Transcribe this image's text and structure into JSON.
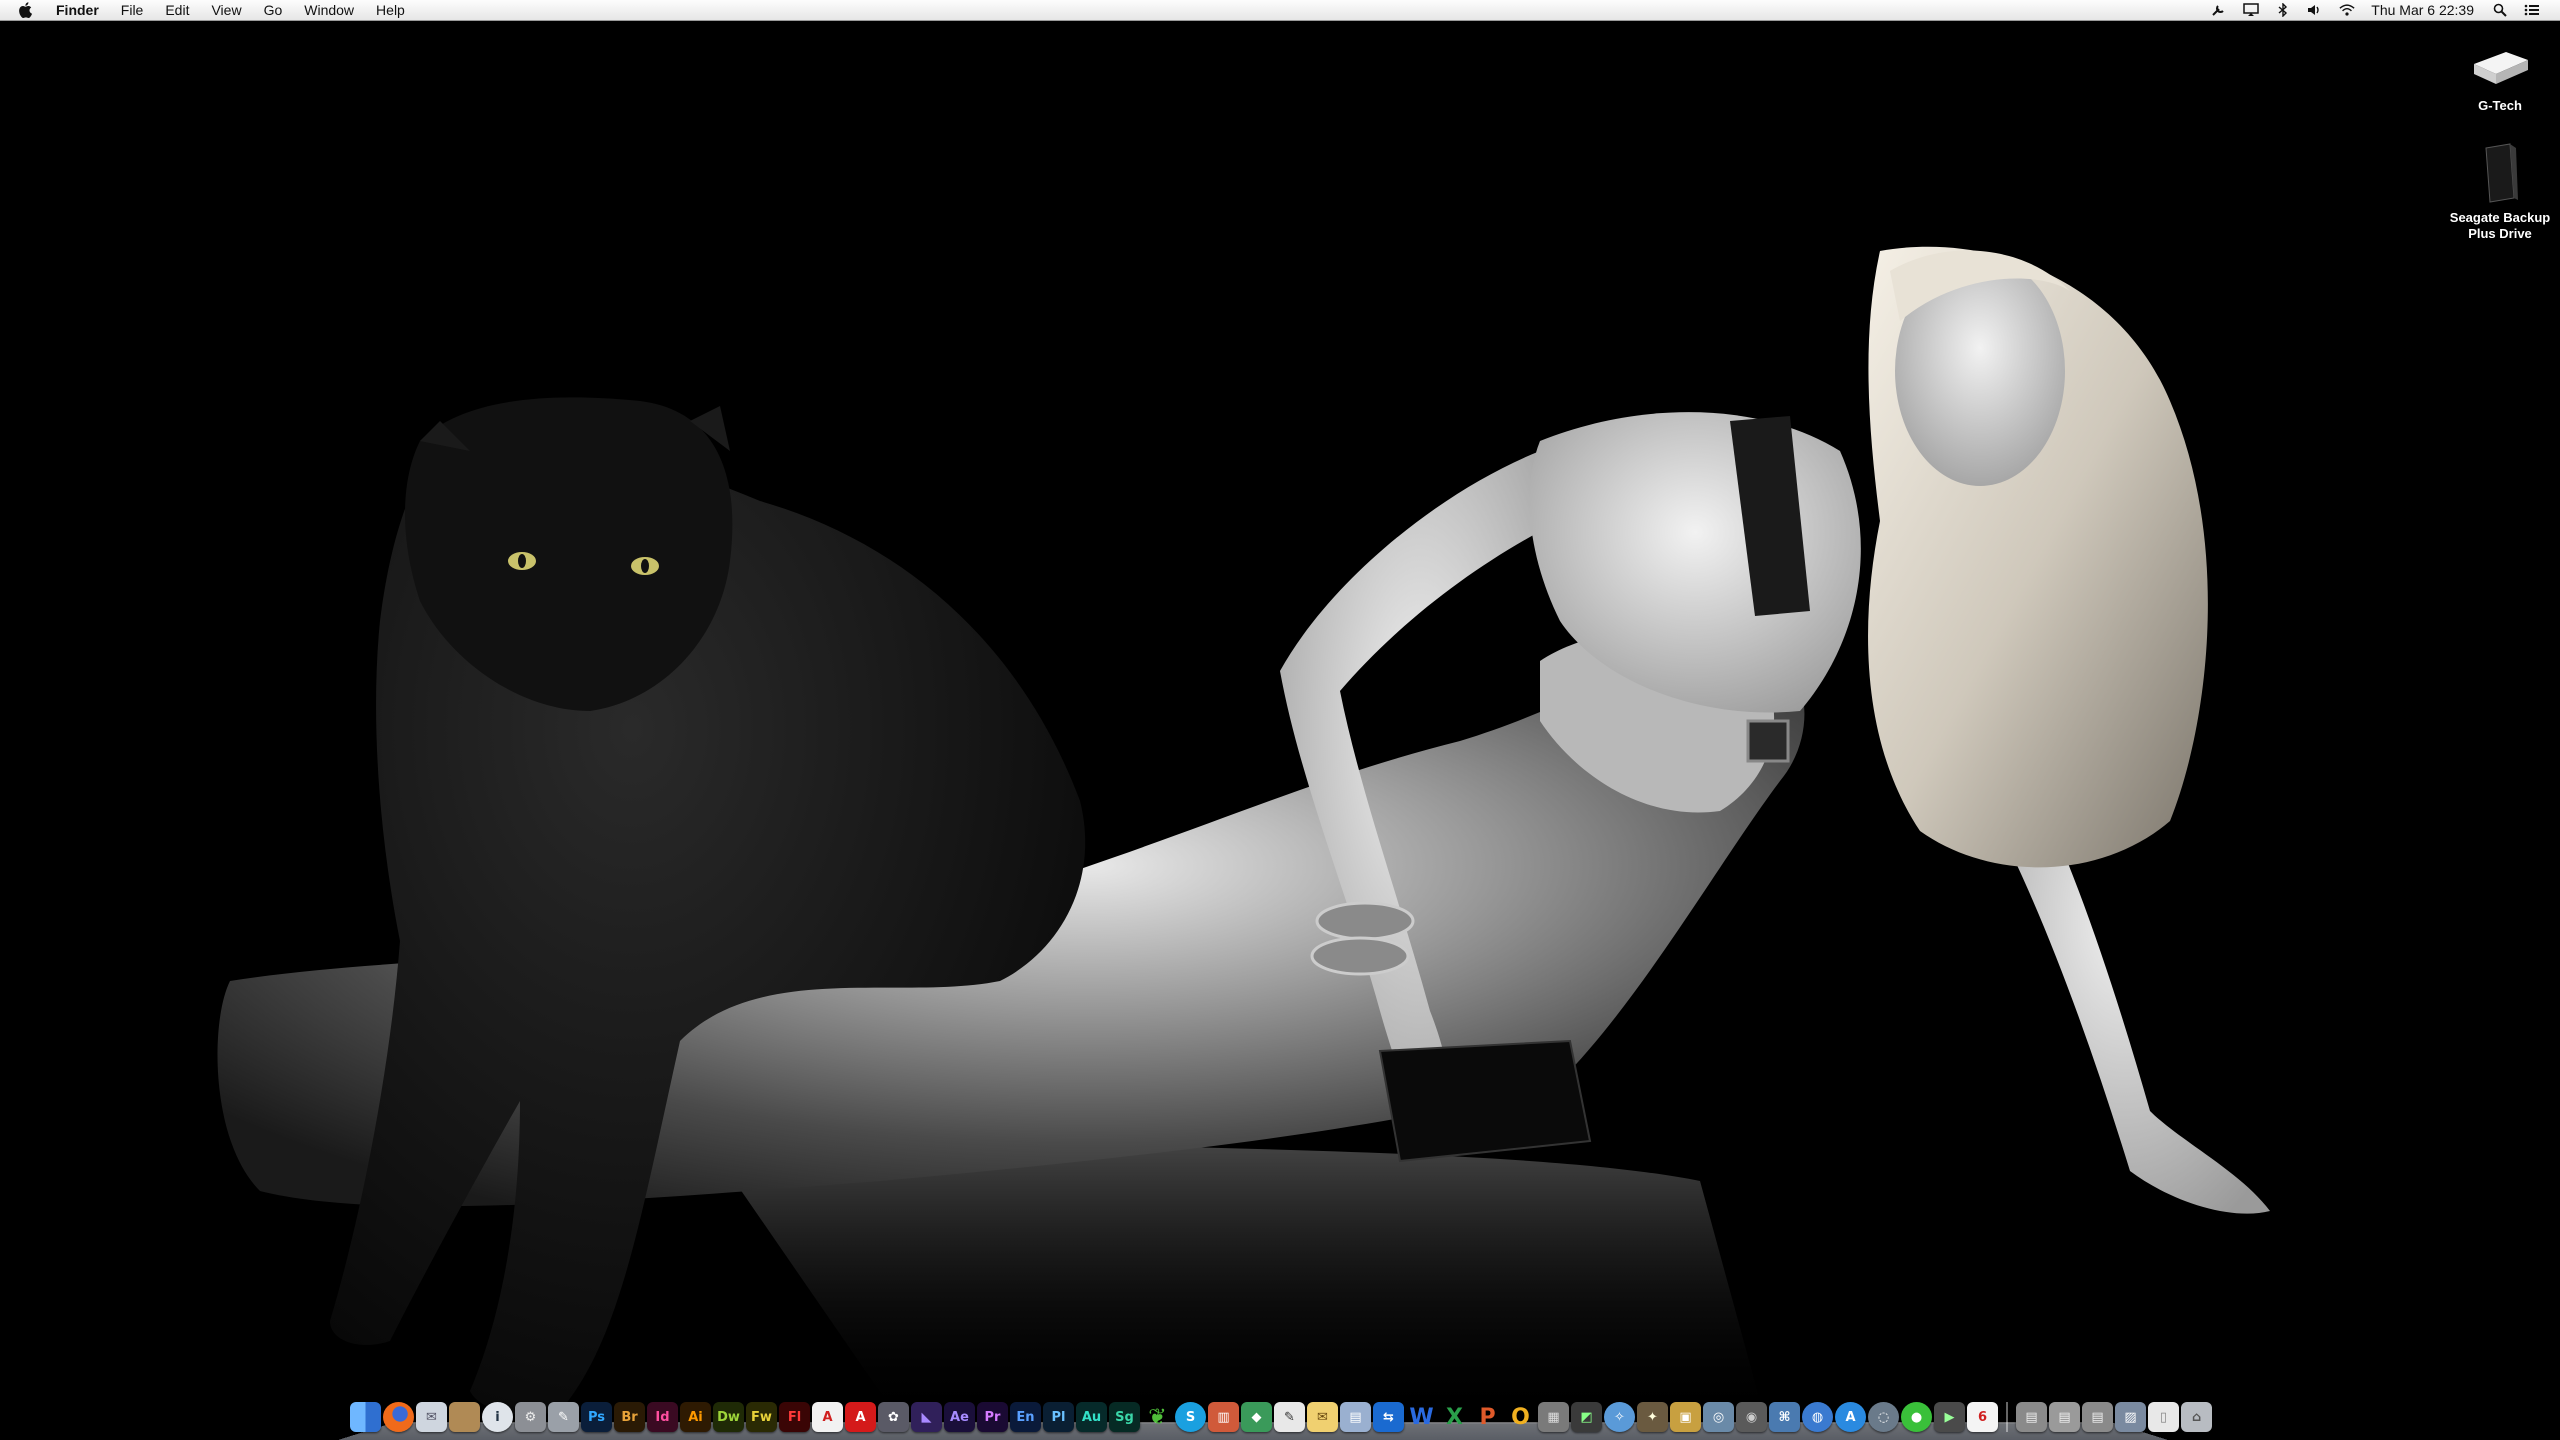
{
  "menubar": {
    "app_name": "Finder",
    "menus": [
      "File",
      "Edit",
      "View",
      "Go",
      "Window",
      "Help"
    ],
    "status_icons": [
      "wrench-icon",
      "display-icon",
      "bluetooth-icon",
      "volume-icon",
      "wifi-icon"
    ],
    "clock": "Thu Mar 6  22:39"
  },
  "desktop": {
    "icons": [
      {
        "name": "G-Tech",
        "type": "external-drive"
      },
      {
        "name": "Seagate Backup Plus Drive",
        "type": "external-drive"
      }
    ]
  },
  "dock": {
    "apps": [
      {
        "name": "finder-icon",
        "text": "",
        "bg": "#3b7fd6",
        "fg": "#fff",
        "shape": "square"
      },
      {
        "name": "firefox-icon",
        "text": "",
        "bg": "#e14d22",
        "fg": "#fff",
        "shape": "round"
      },
      {
        "name": "mail-icon",
        "text": "✉",
        "bg": "#cfd6df",
        "fg": "#556",
        "shape": "square"
      },
      {
        "name": "address-book-icon",
        "text": "",
        "bg": "#b08a55",
        "fg": "#fff",
        "shape": "square"
      },
      {
        "name": "info-icon",
        "text": "i",
        "bg": "#dfe4ea",
        "fg": "#234",
        "shape": "round"
      },
      {
        "name": "system-preferences-icon",
        "text": "⚙",
        "bg": "#8c8f95",
        "fg": "#eee",
        "shape": "square"
      },
      {
        "name": "script-editor-icon",
        "text": "✎",
        "bg": "#9aa0a8",
        "fg": "#fff",
        "shape": "square"
      },
      {
        "name": "photoshop-icon",
        "text": "Ps",
        "bg": "#0a1e3a",
        "fg": "#31a8ff",
        "shape": "square"
      },
      {
        "name": "bridge-icon",
        "text": "Br",
        "bg": "#2a1a05",
        "fg": "#e8a33a",
        "shape": "square"
      },
      {
        "name": "indesign-icon",
        "text": "Id",
        "bg": "#3a0a22",
        "fg": "#ff4fa0",
        "shape": "square"
      },
      {
        "name": "illustrator-icon",
        "text": "Ai",
        "bg": "#2e1a02",
        "fg": "#ff9a00",
        "shape": "square"
      },
      {
        "name": "dreamweaver-icon",
        "text": "Dw",
        "bg": "#1f2a06",
        "fg": "#9ed63a",
        "shape": "square"
      },
      {
        "name": "fireworks-icon",
        "text": "Fw",
        "bg": "#2a2a04",
        "fg": "#e8d23a",
        "shape": "square"
      },
      {
        "name": "flash-icon",
        "text": "Fl",
        "bg": "#3a0505",
        "fg": "#ff3a3a",
        "shape": "square"
      },
      {
        "name": "acrobat-icon",
        "text": "A",
        "bg": "#f2f2f2",
        "fg": "#d02020",
        "shape": "square"
      },
      {
        "name": "adobe-icon",
        "text": "A",
        "bg": "#d41a1a",
        "fg": "#fff",
        "shape": "square"
      },
      {
        "name": "media-encoder-icon",
        "text": "✿",
        "bg": "#5a5a66",
        "fg": "#fff",
        "shape": "square"
      },
      {
        "name": "extension-manager-icon",
        "text": "◣",
        "bg": "#30205a",
        "fg": "#a98aff",
        "shape": "square"
      },
      {
        "name": "after-effects-icon",
        "text": "Ae",
        "bg": "#1a0f3a",
        "fg": "#a78bff",
        "shape": "square"
      },
      {
        "name": "premiere-icon",
        "text": "Pr",
        "bg": "#1a0a33",
        "fg": "#d57bff",
        "shape": "square"
      },
      {
        "name": "encore-icon",
        "text": "En",
        "bg": "#0a1a3a",
        "fg": "#5aa0ff",
        "shape": "square"
      },
      {
        "name": "prelude-icon",
        "text": "Pl",
        "bg": "#0a1f33",
        "fg": "#6ac2ff",
        "shape": "square"
      },
      {
        "name": "audition-icon",
        "text": "Au",
        "bg": "#062a2a",
        "fg": "#33e0c8",
        "shape": "square"
      },
      {
        "name": "speedgrade-icon",
        "text": "Sg",
        "bg": "#062a24",
        "fg": "#3ad6a8",
        "shape": "square"
      },
      {
        "name": "leaf-icon",
        "text": "❦",
        "bg": "transparent",
        "fg": "#4fbf3a",
        "shape": "glyph"
      },
      {
        "name": "skype-icon",
        "text": "S",
        "bg": "#1aa0e0",
        "fg": "#fff",
        "shape": "round"
      },
      {
        "name": "chart-app-icon",
        "text": "▥",
        "bg": "#d05a3a",
        "fg": "#fff",
        "shape": "square"
      },
      {
        "name": "cube-app-icon",
        "text": "◆",
        "bg": "#3a9a5a",
        "fg": "#fff",
        "shape": "square"
      },
      {
        "name": "textedit-icon",
        "text": "✎",
        "bg": "#e8e8e8",
        "fg": "#333",
        "shape": "square"
      },
      {
        "name": "notes-icon",
        "text": "✉",
        "bg": "#f0d070",
        "fg": "#6a4a10",
        "shape": "square"
      },
      {
        "name": "preview-icon",
        "text": "▤",
        "bg": "#9ab0d0",
        "fg": "#fff",
        "shape": "square"
      },
      {
        "name": "teamviewer-icon",
        "text": "⇆",
        "bg": "#1a6ad0",
        "fg": "#fff",
        "shape": "square"
      },
      {
        "name": "word-icon",
        "text": "W",
        "bg": "transparent",
        "fg": "#2a6ae0",
        "shape": "glyph"
      },
      {
        "name": "excel-icon",
        "text": "X",
        "bg": "transparent",
        "fg": "#2aa04a",
        "shape": "glyph"
      },
      {
        "name": "powerpoint-icon",
        "text": "P",
        "bg": "transparent",
        "fg": "#e05a2a",
        "shape": "glyph"
      },
      {
        "name": "outlook-icon",
        "text": "O",
        "bg": "transparent",
        "fg": "#f0b020",
        "shape": "glyph"
      },
      {
        "name": "calculator-icon",
        "text": "▦",
        "bg": "#7a7a7a",
        "fg": "#ddd",
        "shape": "square"
      },
      {
        "name": "activity-monitor-icon",
        "text": "◩",
        "bg": "#3a3a3a",
        "fg": "#8f8",
        "shape": "square"
      },
      {
        "name": "safari-icon",
        "text": "✧",
        "bg": "#5a9ad8",
        "fg": "#fff",
        "shape": "round"
      },
      {
        "name": "utility-icon",
        "text": "✦",
        "bg": "#6a5a40",
        "fg": "#ffd",
        "shape": "square"
      },
      {
        "name": "archive-icon",
        "text": "▣",
        "bg": "#c8a040",
        "fg": "#fff",
        "shape": "square"
      },
      {
        "name": "disk-utility-icon",
        "text": "◎",
        "bg": "#6a8aa8",
        "fg": "#fff",
        "shape": "square"
      },
      {
        "name": "camera-icon",
        "text": "◉",
        "bg": "#5a5a5a",
        "fg": "#ccc",
        "shape": "square"
      },
      {
        "name": "network-icon",
        "text": "⌘",
        "bg": "#4a7ab0",
        "fg": "#fff",
        "shape": "square"
      },
      {
        "name": "globe-icon",
        "text": "◍",
        "bg": "#3a7ad0",
        "fg": "#fff",
        "shape": "round"
      },
      {
        "name": "app-store-icon",
        "text": "A",
        "bg": "#2a8ae0",
        "fg": "#fff",
        "shape": "round"
      },
      {
        "name": "search-app-icon",
        "text": "◌",
        "bg": "#6a7a8a",
        "fg": "#fff",
        "shape": "round"
      },
      {
        "name": "messages-icon",
        "text": "●",
        "bg": "#3ac03a",
        "fg": "#fff",
        "shape": "round"
      },
      {
        "name": "facetime-icon",
        "text": "▶",
        "bg": "#4a4a4a",
        "fg": "#9f9",
        "shape": "square"
      },
      {
        "name": "calendar-icon",
        "text": "6",
        "bg": "#f4f4f4",
        "fg": "#d02020",
        "shape": "square"
      },
      {
        "name": "downloads-stack-icon",
        "text": "▤",
        "bg": "#8a8a8a",
        "fg": "#eee",
        "shape": "square"
      },
      {
        "name": "documents-stack-icon",
        "text": "▤",
        "bg": "#9a9a9a",
        "fg": "#eee",
        "shape": "square"
      },
      {
        "name": "applications-stack-icon",
        "text": "▤",
        "bg": "#8a8a8a",
        "fg": "#eee",
        "shape": "square"
      },
      {
        "name": "pictures-stack-icon",
        "text": "▨",
        "bg": "#7a8aa0",
        "fg": "#fff",
        "shape": "square"
      },
      {
        "name": "file-stack-icon",
        "text": "▯",
        "bg": "#e8e8e8",
        "fg": "#888",
        "shape": "square"
      },
      {
        "name": "trash-icon",
        "text": "⌂",
        "bg": "#b8bcc2",
        "fg": "#555",
        "shape": "square"
      }
    ]
  }
}
